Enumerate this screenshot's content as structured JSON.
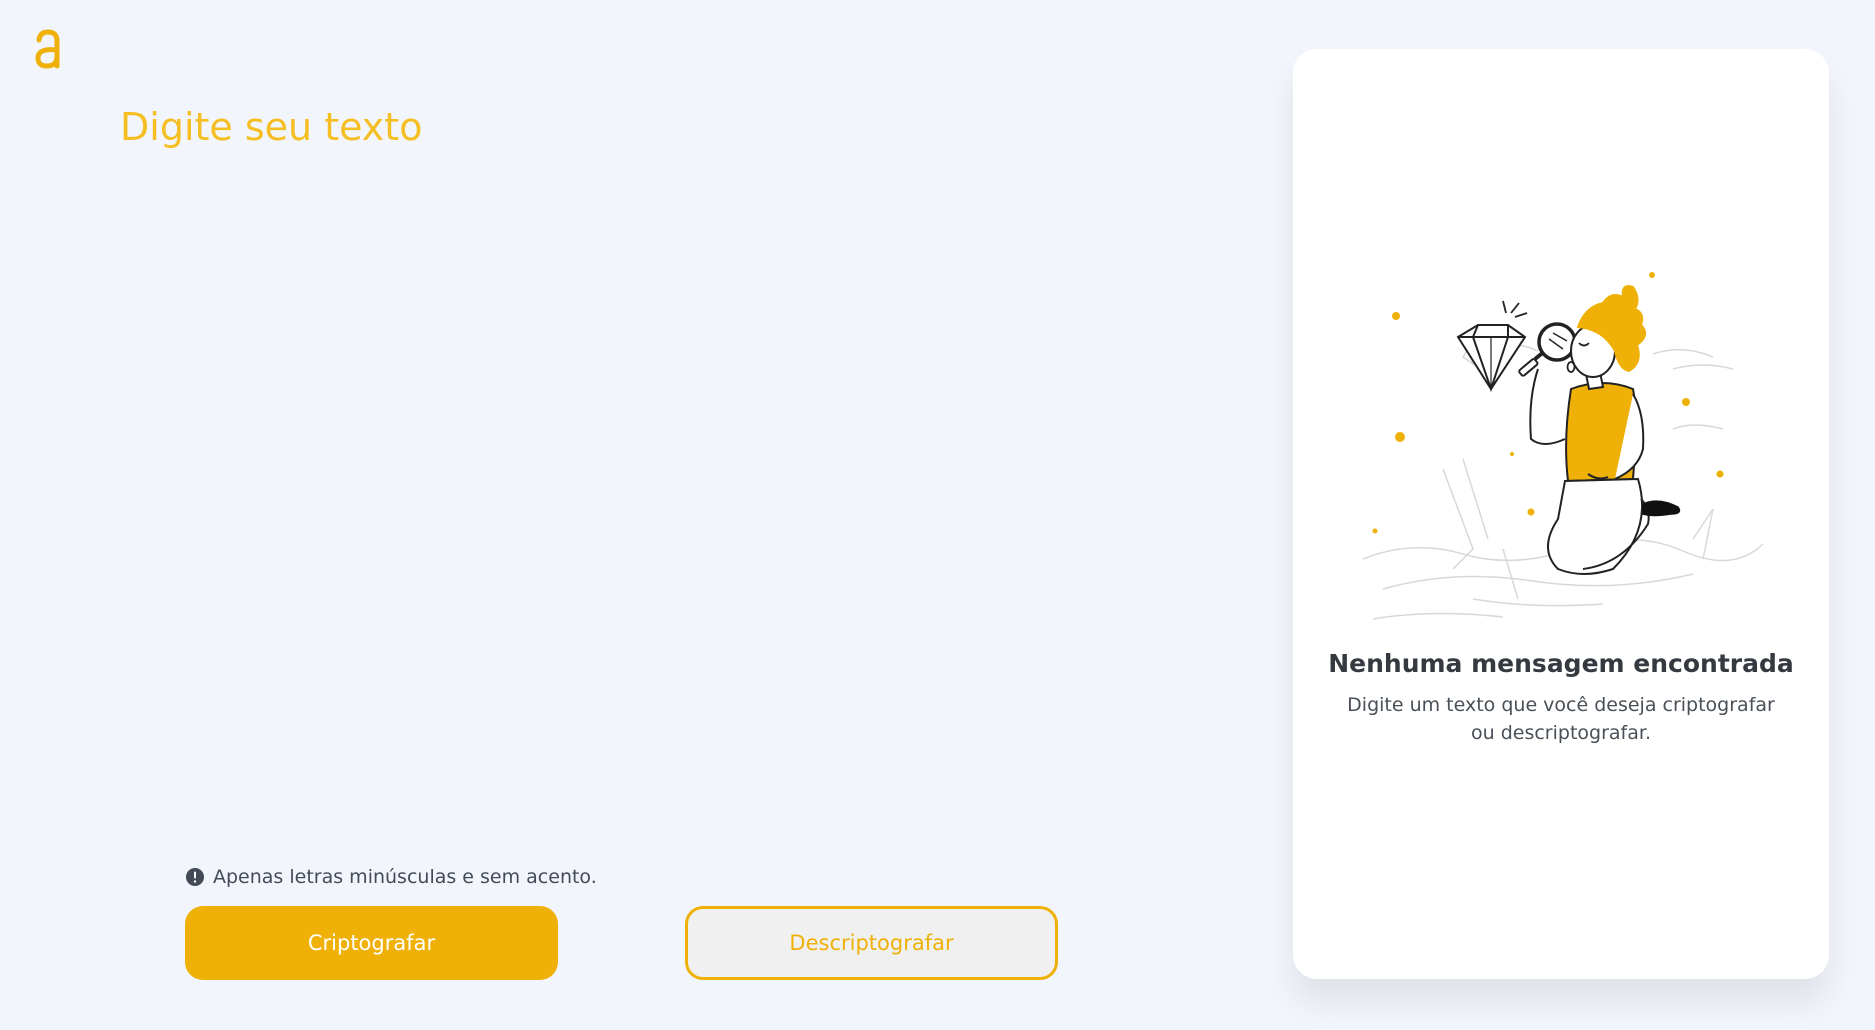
{
  "logo": {
    "icon": "alura-a-logo-icon",
    "color": "#efb007"
  },
  "input": {
    "placeholder": "Digite seu texto",
    "value": ""
  },
  "hint": {
    "icon": "exclamation-circle-icon",
    "text": "Apenas letras minúsculas e sem acento."
  },
  "buttons": {
    "encrypt_label": "Criptografar",
    "decrypt_label": "Descriptografar"
  },
  "result": {
    "illustration": "person-searching-diamond-with-magnifying-glass",
    "title": "Nenhuma mensagem encontrada",
    "text": "Digite um texto que você deseja criptografar ou descriptografar."
  },
  "colors": {
    "accent": "#efb007",
    "background": "#f2f5fc",
    "panel": "#ffffff",
    "text_dark": "#343a40"
  }
}
